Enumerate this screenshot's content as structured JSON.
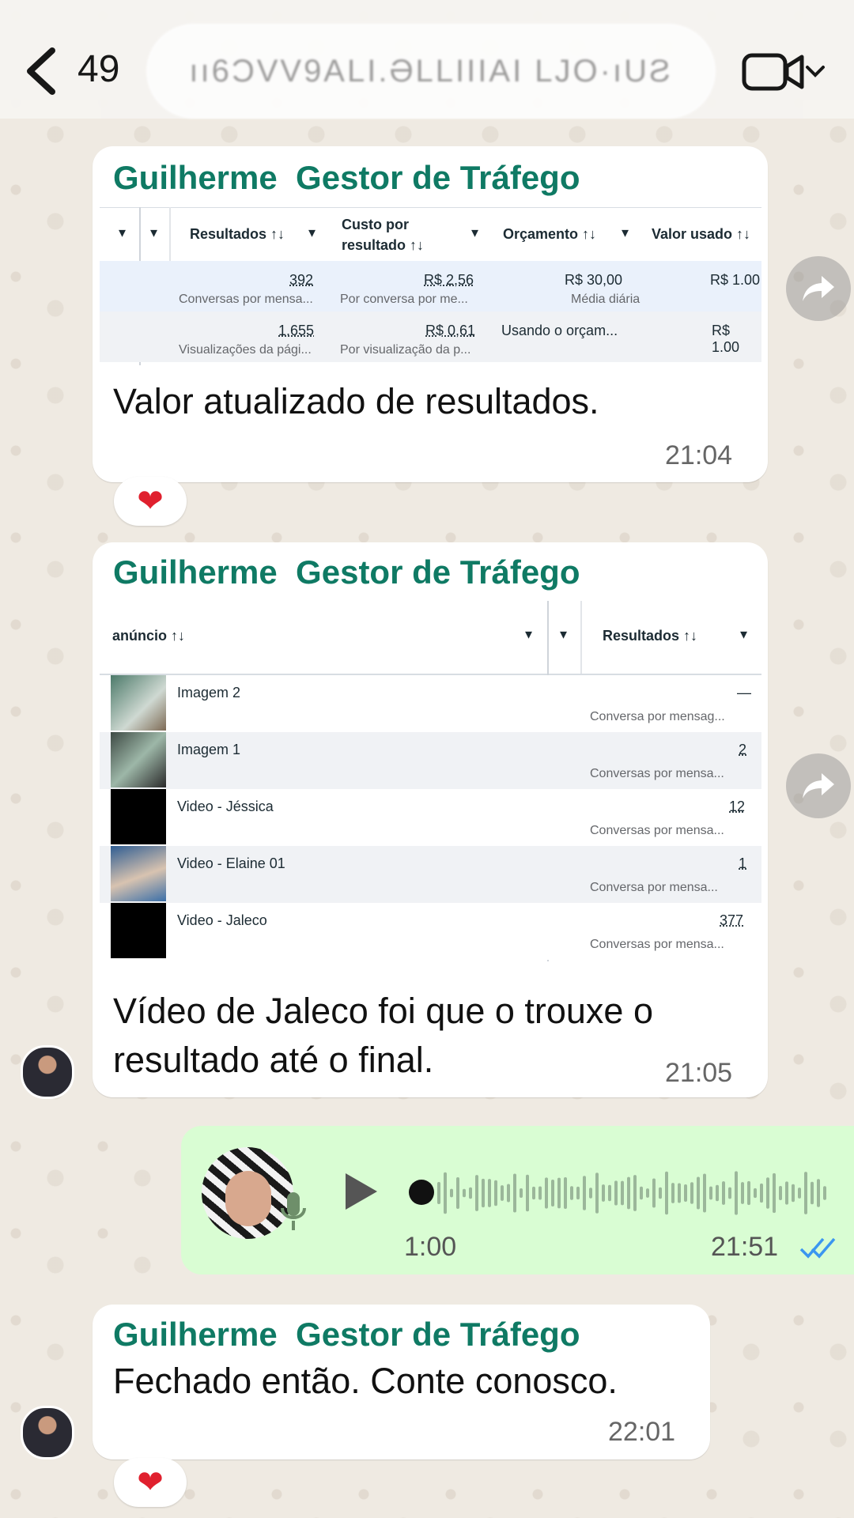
{
  "header": {
    "unread_count": "49",
    "contact_name": "ıı6ƆVV9ALI.ƏLLIIIAI LJO·ıUƧ",
    "video_icon": "video-camera-icon",
    "back_icon": "chevron-left-icon"
  },
  "messages": [
    {
      "sender": "Guilherme  Gestor de Tráfego",
      "text": "Valor atualizado de resultados.",
      "time": "21:04",
      "reaction": "❤",
      "table": {
        "headers": [
          "Resultados ↑↓",
          "Custo por\nresultado ↑↓",
          "Orçamento ↑↓",
          "Valor usado ↑↓"
        ],
        "header_line1": "Custo por",
        "header_line2": "resultado ↑↓",
        "rows": [
          {
            "resultados": "392",
            "resultados_sub": "Conversas por mensa...",
            "custo": "R$ 2,56",
            "custo_sub": "Por conversa por me...",
            "orcamento": "R$ 30,00",
            "orcamento_sub": "Média diária",
            "valor": "R$ 1.00"
          },
          {
            "resultados": "1.655",
            "resultados_sub": "Visualizações da pági...",
            "custo": "R$ 0,61",
            "custo_sub": "Por visualização da p...",
            "orcamento": "Usando o orçam...",
            "orcamento_sub": "",
            "valor": "R$ 1.00"
          }
        ]
      }
    },
    {
      "sender": "Guilherme  Gestor de Tráfego",
      "text": "Vídeo de Jaleco foi que o trouxe o resultado até o final.",
      "time": "21:05",
      "table": {
        "col1_header": "anúncio ↑↓",
        "col2_header": "Resultados ↑↓",
        "rows": [
          {
            "name": "Imagem 2",
            "value": "—",
            "sub": "Conversa por mensag..."
          },
          {
            "name": "Imagem 1",
            "value": "2",
            "sub": "Conversas por mensa..."
          },
          {
            "name": "Video - Jéssica",
            "value": "12",
            "sub": "Conversas por mensa..."
          },
          {
            "name": "Video - Elaine 01",
            "value": "1",
            "sub": "Conversa por mensa..."
          },
          {
            "name": "Video - Jaleco",
            "value": "377",
            "sub": "Conversas por mensa..."
          }
        ]
      }
    },
    {
      "type": "voice",
      "duration": "1:00",
      "time": "21:51",
      "status": "read"
    },
    {
      "sender": "Guilherme  Gestor de Tráfego",
      "text": "Fechado então. Conte conosco.",
      "time": "22:01",
      "reaction": "❤"
    }
  ],
  "colors": {
    "sender": "#0f7a64",
    "outgoing": "#d9fdd3",
    "ticks": "#3b96f0"
  }
}
